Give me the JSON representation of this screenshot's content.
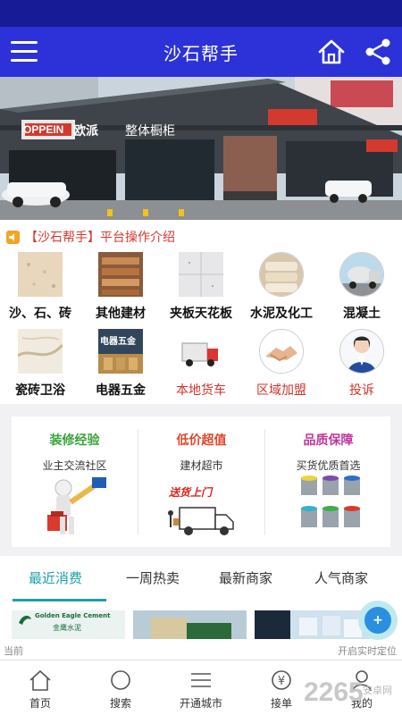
{
  "app": {
    "title": "沙石帮手"
  },
  "header": {
    "menu_icon": "menu-icon",
    "home_icon": "home-icon",
    "share_icon": "share-icon"
  },
  "banner": {
    "store_sign": "OPPEIN",
    "store_cn": "欧派",
    "store_sub": "整体橱柜"
  },
  "notice": {
    "icon": "speaker-icon",
    "text": "【沙石帮手】平台操作介绍"
  },
  "categories": [
    {
      "label": "沙、石、砖",
      "icon": "sand-icon"
    },
    {
      "label": "其他建材",
      "icon": "building-material-icon"
    },
    {
      "label": "夹板天花板",
      "icon": "ceiling-board-icon"
    },
    {
      "label": "水泥及化工",
      "icon": "cement-bag-icon"
    },
    {
      "label": "混凝土",
      "icon": "concrete-mixer-icon"
    },
    {
      "label": "瓷砖卫浴",
      "icon": "tile-icon"
    },
    {
      "label": "电器五金",
      "icon": "hardware-icon",
      "thumb_text": "电器五金"
    },
    {
      "label": "本地货车",
      "icon": "truck-icon"
    },
    {
      "label": "区域加盟",
      "icon": "handshake-icon"
    },
    {
      "label": "投诉",
      "icon": "service-agent-icon"
    }
  ],
  "promo": [
    {
      "title": "装修经验",
      "subtitle": "业主交流社区",
      "color": "#3aa33c",
      "icon": "painter-icon"
    },
    {
      "title": "低价超值",
      "subtitle": "建材超市",
      "color": "#e0452b",
      "icon": "delivery-truck-icon",
      "slogan": "送货上门"
    },
    {
      "title": "品质保障",
      "subtitle": "买货优质首选",
      "color": "#c2359d",
      "icon": "paint-buckets-icon"
    }
  ],
  "tabs": [
    {
      "label": "最近消费",
      "active": true
    },
    {
      "label": "一周热卖",
      "active": false
    },
    {
      "label": "最新商家",
      "active": false
    },
    {
      "label": "人气商家",
      "active": false
    }
  ],
  "strip": {
    "card1_en": "Golden Eagle Cement",
    "card1_cn": "金鹰水泥"
  },
  "location": {
    "left": "当前",
    "right": "开启实时定位"
  },
  "fab": {
    "label": "+"
  },
  "bottom_nav": [
    {
      "label": "首页",
      "icon": "home-icon"
    },
    {
      "label": "搜索",
      "icon": "search-icon"
    },
    {
      "label": "开通城市",
      "icon": "list-icon"
    },
    {
      "label": "接单",
      "icon": "yuan-icon",
      "glyph": "¥"
    },
    {
      "label": "我的",
      "icon": "user-icon"
    }
  ],
  "watermark": {
    "brand": "2265",
    "site": "安卓网"
  }
}
